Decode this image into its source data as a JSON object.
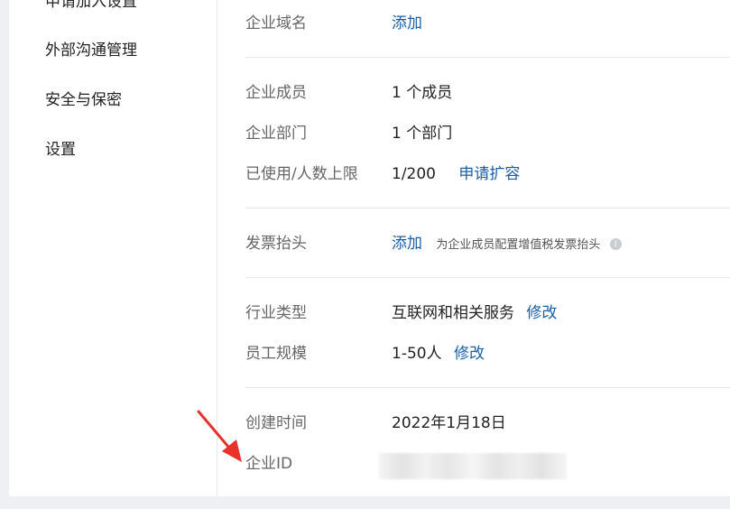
{
  "sidebar": {
    "items": [
      {
        "label": "申请加入设置"
      },
      {
        "label": "外部沟通管理"
      },
      {
        "label": "安全与保密"
      },
      {
        "label": "设置"
      }
    ]
  },
  "info": {
    "domain": {
      "label": "企业域名",
      "action": "添加"
    },
    "members": {
      "label": "企业成员",
      "value": "1 个成员"
    },
    "departments": {
      "label": "企业部门",
      "value": "1 个部门"
    },
    "capacity": {
      "label": "已使用/人数上限",
      "value": "1/200",
      "action": "申请扩容"
    },
    "invoice": {
      "label": "发票抬头",
      "action": "添加",
      "hint": "为企业成员配置增值税发票抬头",
      "hint_icon": "info-icon"
    },
    "industry": {
      "label": "行业类型",
      "value": "互联网和相关服务",
      "action": "修改"
    },
    "scale": {
      "label": "员工规模",
      "value": "1-50人",
      "action": "修改"
    },
    "created": {
      "label": "创建时间",
      "value": "2022年1月18日"
    },
    "corp_id": {
      "label": "企业ID"
    }
  },
  "colors": {
    "link": "#1a5fa6",
    "annotation_arrow": "#e8322b"
  }
}
